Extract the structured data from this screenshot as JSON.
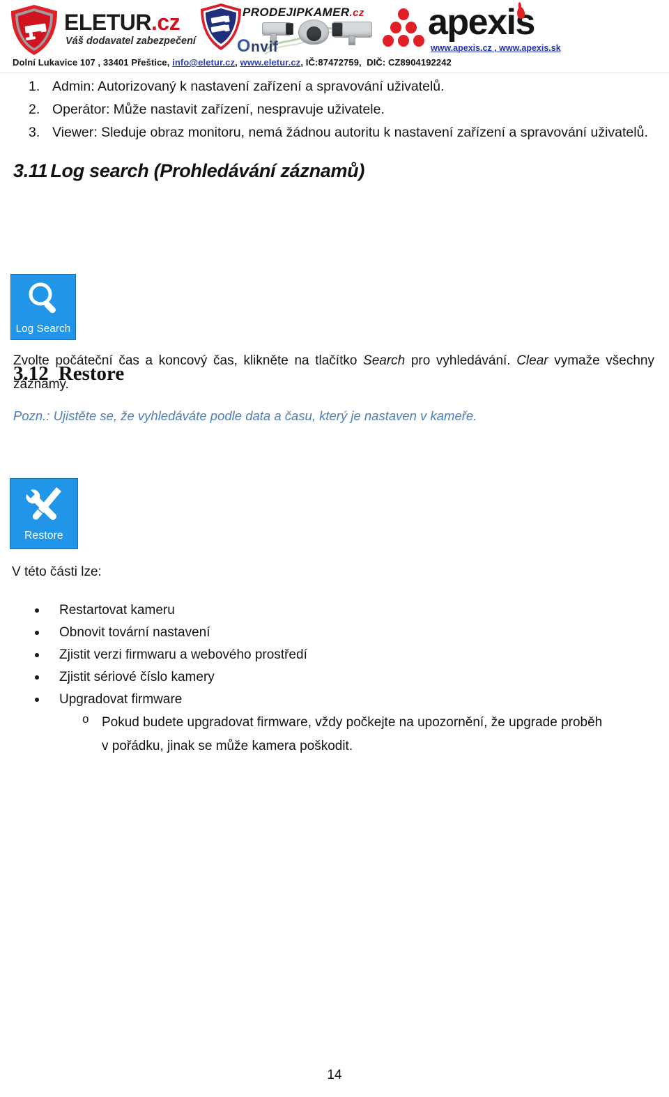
{
  "header": {
    "eletur": {
      "name_main": "ELETUR",
      "name_tld": ".cz",
      "tagline": "Váš dodavatel zabezpečení"
    },
    "prodejipkamer": {
      "name_main": "PRODEJIPKAMER",
      "name_tld": ".cz",
      "onvif_o": "O",
      "onvif_rest": "nvif"
    },
    "apexis": {
      "name": "apexis",
      "urls": "www.apexis.cz , www.apexis.sk"
    },
    "contact": {
      "address": "Dolní Lukavice 107 , 33401 Přeštice,",
      "email": "info@eletur.cz",
      "comma1": ",",
      "web": "www.eletur.cz",
      "comma2": ",",
      "ico": "IČ:87472759,",
      "dic": "DIČ: CZ8904192242"
    }
  },
  "roles": [
    {
      "num": "1.",
      "text": "Admin: Autorizovaný k nastavení zařízení a spravování uživatelů."
    },
    {
      "num": "2.",
      "text": "Operátor: Může nastavit zařízení, nespravuje uživatele."
    },
    {
      "num": "3.",
      "text": "Viewer: Sleduje obraz monitoru, nemá žádnou autoritu k nastavení zařízení a spravování uživatelů."
    }
  ],
  "section_log_search": {
    "number": "3.11",
    "title": "Log search (Prohledávání záznamů)",
    "icon_label": "Log Search",
    "icon_name": "magnifier-icon",
    "icon_color": "#2196E8",
    "paragraph": {
      "part1": "Zvolte počáteční čas a koncový čas, klikněte na tlačítko ",
      "em1": "Search",
      "part2": " pro vyhledávání. ",
      "em2": "Clear",
      "part3": " vymaže všechny záznamy."
    },
    "note": "Pozn.: Ujistěte se, že vyhledáváte podle data a času, který je nastaven v kameře.",
    "note_color": "#4A7FBD"
  },
  "section_restore": {
    "number": "3.12",
    "title": "Restore",
    "icon_label": "Restore",
    "icon_name": "wrench-screwdriver-icon",
    "icon_color": "#2196E8",
    "intro": "V této části lze:",
    "bullets": [
      "Restartovat kameru",
      "Obnovit tovární nastavení",
      "Zjistit verzi firmwaru a webového prostředí",
      "Zjistit sériové číslo kamery",
      "Upgradovat firmware"
    ],
    "sub_bullet": {
      "marker": "o",
      "line1": "Pokud budete upgradovat firmware, vždy počkejte na upozornění, že upgrade proběh",
      "line2": "v pořádku, jinak se může kamera poškodit."
    }
  },
  "footer": {
    "page_number": "14"
  }
}
